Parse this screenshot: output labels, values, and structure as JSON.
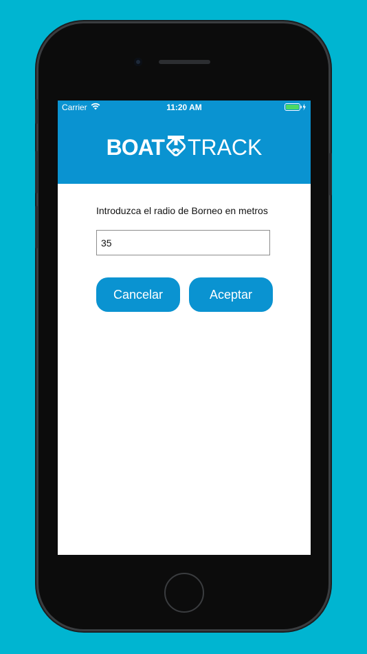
{
  "status_bar": {
    "carrier": "Carrier",
    "time": "11:20 AM"
  },
  "header": {
    "logo_left": "BOAT",
    "logo_right": "TRACK",
    "bg_color": "#0a93d1"
  },
  "form": {
    "prompt": "Introduzca el radio de Borneo en metros",
    "value": "35"
  },
  "buttons": {
    "cancel": "Cancelar",
    "accept": "Aceptar"
  },
  "colors": {
    "background": "#00b5d1",
    "accent": "#0a93d1",
    "battery": "#4cd964"
  }
}
